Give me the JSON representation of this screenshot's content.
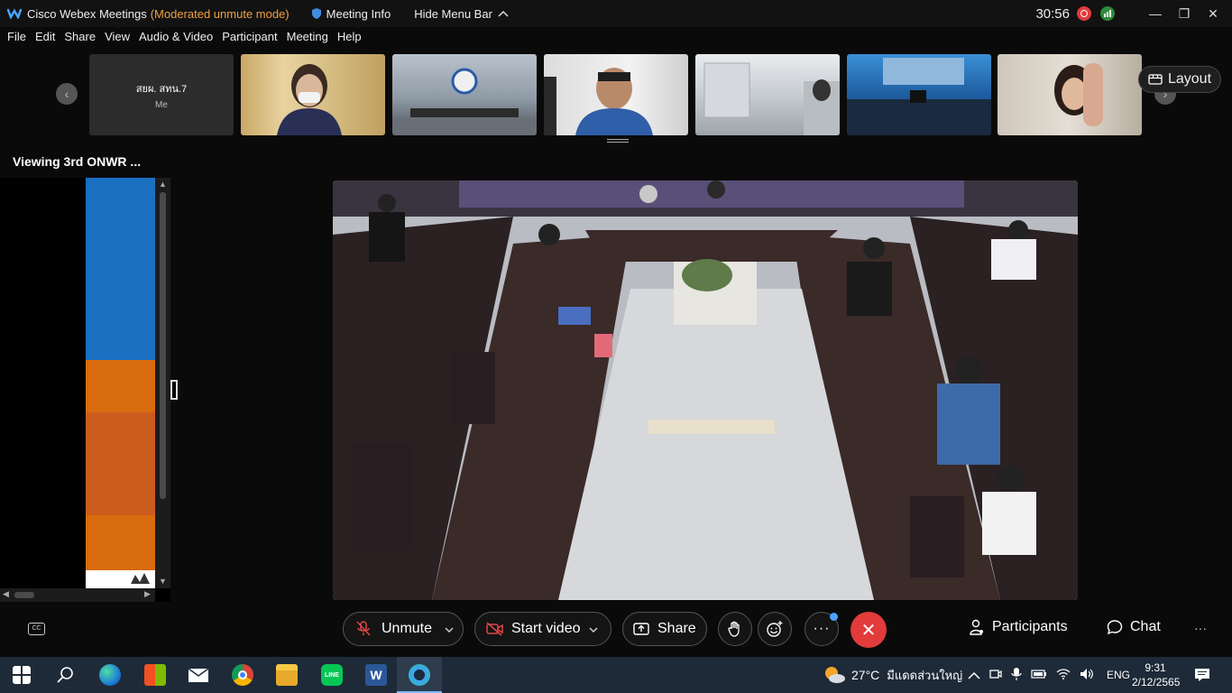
{
  "titlebar": {
    "app_name": "Cisco Webex Meetings",
    "mode": "(Moderated unmute mode)",
    "meeting_info": "Meeting Info",
    "hide_menu_bar": "Hide Menu Bar",
    "timer": "30:56"
  },
  "menu": [
    "File",
    "Edit",
    "Share",
    "View",
    "Audio & Video",
    "Participant",
    "Meeting",
    "Help"
  ],
  "strip": {
    "me_name": "สยผ. สทน.7",
    "me_label": "Me",
    "layout_label": "Layout"
  },
  "viewing_label": "Viewing 3rd ONWR ...",
  "controls": {
    "unmute": "Unmute",
    "start_video": "Start video",
    "share": "Share",
    "participants": "Participants",
    "chat": "Chat"
  },
  "taskbar": {
    "temperature": "27°C",
    "weather": "มีแดดส่วนใหญ่",
    "language": "ENG",
    "time": "9:31",
    "date": "2/12/2565"
  },
  "colors": {
    "accent_end": "#e23b3b",
    "mode_text": "#f0a040",
    "share_blue": "#1a6fc0",
    "share_orange": "#d86b0e"
  }
}
